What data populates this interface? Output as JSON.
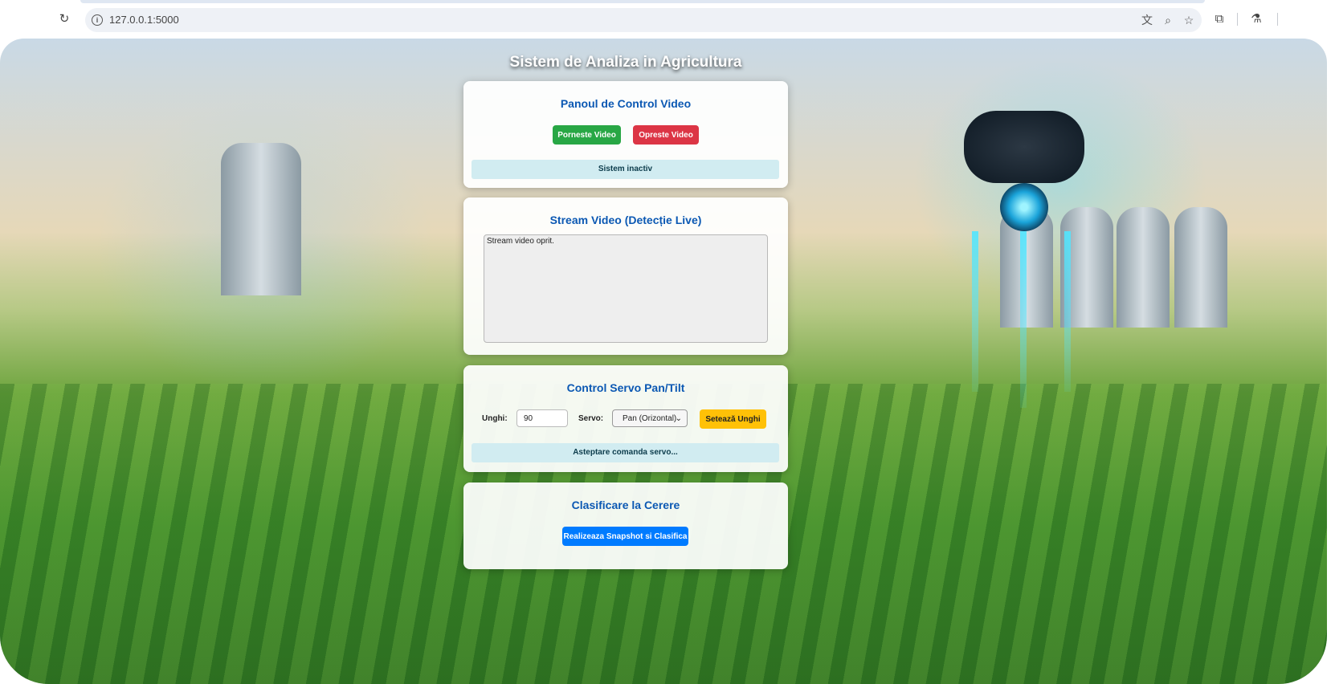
{
  "browser": {
    "url": "127.0.0.1:5000"
  },
  "page": {
    "title": "Sistem de Analiza in Agricultura"
  },
  "video_panel": {
    "title": "Panoul de Control Video",
    "start_label": "Porneste Video",
    "stop_label": "Opreste Video",
    "status": "Sistem inactiv"
  },
  "stream_panel": {
    "title": "Stream Video (Detecție Live)",
    "image_alt": "Stream video oprit."
  },
  "servo_panel": {
    "title": "Control Servo Pan/Tilt",
    "angle_label": "Unghi:",
    "angle_value": "90",
    "servo_label": "Servo:",
    "servo_selected": "Pan (Orizontal)",
    "set_label": "Setează Unghi",
    "status": "Asteptare comanda servo..."
  },
  "classify_panel": {
    "title": "Clasificare la Cerere",
    "button_label": "Realizeaza Snapshot si Clasifica"
  },
  "colors": {
    "start_button": "#28a745",
    "stop_button": "#dc3545",
    "set_button": "#ffc107",
    "classify_button": "#007bff",
    "heading": "#0b58b3",
    "status_bg": "#d1ecf1"
  }
}
